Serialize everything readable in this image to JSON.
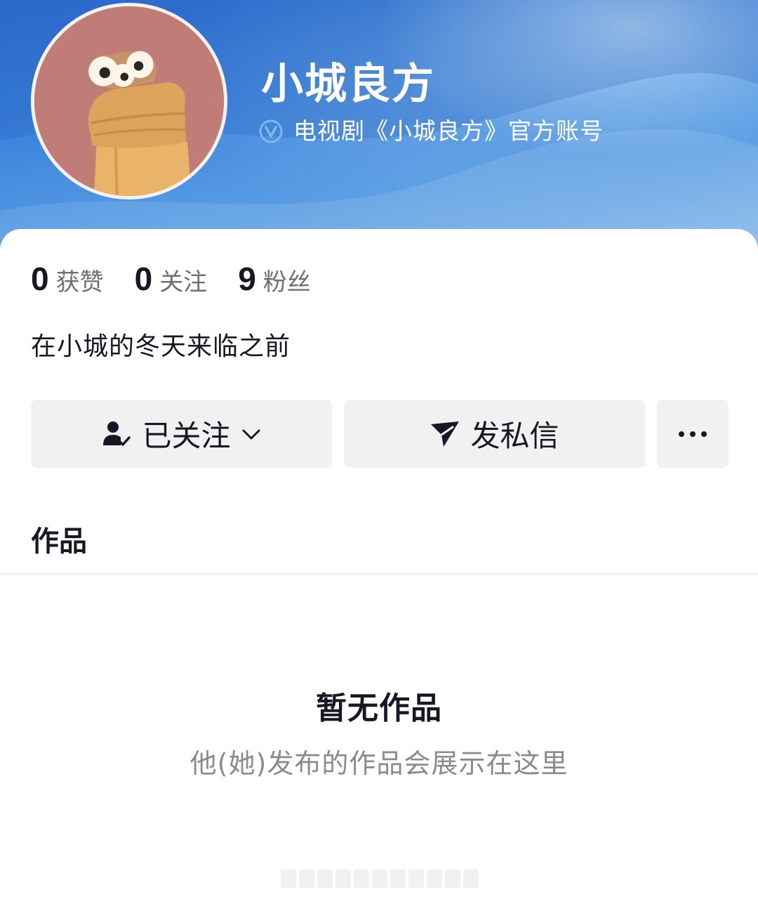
{
  "profile": {
    "name": "小城良方",
    "verified_text": "电视剧《小城良方》官方账号",
    "bio": "在小城的冬天来临之前"
  },
  "stats": [
    {
      "value": "0",
      "label": "获赞"
    },
    {
      "value": "0",
      "label": "关注"
    },
    {
      "value": "9",
      "label": "粉丝"
    }
  ],
  "actions": {
    "follow_label": "已关注",
    "message_label": "发私信",
    "more_icon": "more-dots-icon"
  },
  "works": {
    "tab_label": "作品",
    "empty_title": "暂无作品",
    "empty_subtitle": "他(她)发布的作品会展示在这里"
  },
  "colors": {
    "banner_blue": "#3d85dd",
    "button_bg": "#f1f1f2",
    "text_primary": "#161823",
    "text_secondary": "#8a8b91",
    "verified_badge": "#7fb6f0"
  },
  "icons": {
    "verified": "verified-v-icon",
    "follow": "user-check-icon",
    "dropdown": "chevron-down-icon",
    "message": "paper-plane-icon"
  }
}
